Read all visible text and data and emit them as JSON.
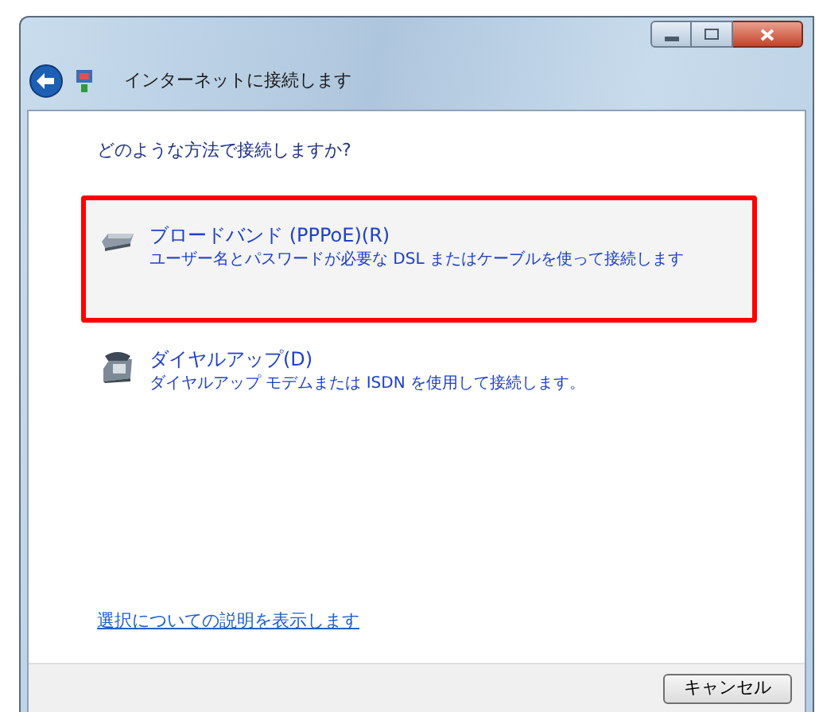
{
  "window": {
    "title": "インターネットに接続します"
  },
  "question": "どのような方法で接続しますか?",
  "options": [
    {
      "kind": "broadband",
      "title": "ブロードバンド (PPPoE)(R)",
      "description": "ユーザー名とパスワードが必要な DSL またはケーブルを使って接続します",
      "selected": true
    },
    {
      "kind": "dialup",
      "title": "ダイヤルアップ(D)",
      "description": "ダイヤルアップ モデムまたは ISDN を使用して接続します。",
      "selected": false
    }
  ],
  "help_link": "選択についての説明を表示します",
  "buttons": [
    "キャンセル"
  ]
}
